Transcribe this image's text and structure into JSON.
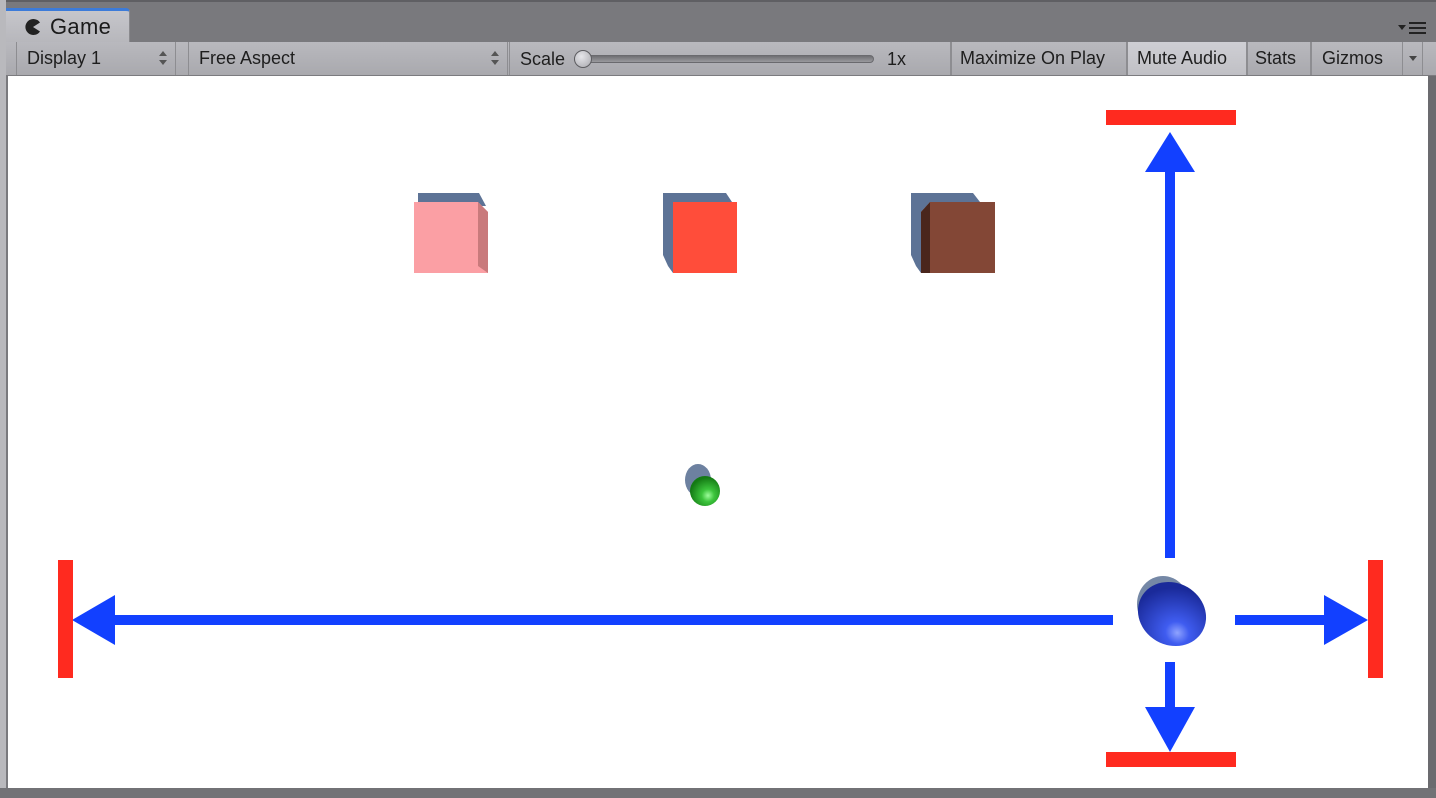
{
  "window": {
    "tab_label": "Game",
    "tab_icon": "pacman-game-icon",
    "menu_icon": "panel-menu-icon"
  },
  "toolbar": {
    "display": {
      "value": "Display 1",
      "icon": "updown-arrows-icon"
    },
    "aspect": {
      "value": "Free Aspect",
      "icon": "updown-arrows-icon"
    },
    "scale": {
      "label": "Scale",
      "value": "1x",
      "slider_fraction": 0.0
    },
    "maximize_on_play": {
      "label": "Maximize On Play",
      "active": false
    },
    "mute_audio": {
      "label": "Mute Audio",
      "active": true
    },
    "stats": {
      "label": "Stats",
      "active": false
    },
    "gizmos": {
      "label": "Gizmos",
      "icon": "dropdown-arrow-icon"
    }
  },
  "scene": {
    "background": "#ffffff",
    "cubes": [
      {
        "name": "pink-cube",
        "color": "#fb9fa4",
        "side_color": "#c97a7c"
      },
      {
        "name": "red-cube",
        "color": "#ff4d3a",
        "side_color": "#e04430"
      },
      {
        "name": "brown-cube",
        "color": "#834736",
        "side_color": "#4a261c"
      }
    ],
    "shadow_color": "#5d7396",
    "ball": {
      "name": "green-ball",
      "color": "#2fb52f"
    },
    "player": {
      "name": "blue-player-sphere",
      "color": "#2b45d8"
    },
    "arrow_color": "#1240ff",
    "boundary_color": "#ff2a1f",
    "arrows": [
      "up",
      "down",
      "left",
      "right"
    ]
  }
}
